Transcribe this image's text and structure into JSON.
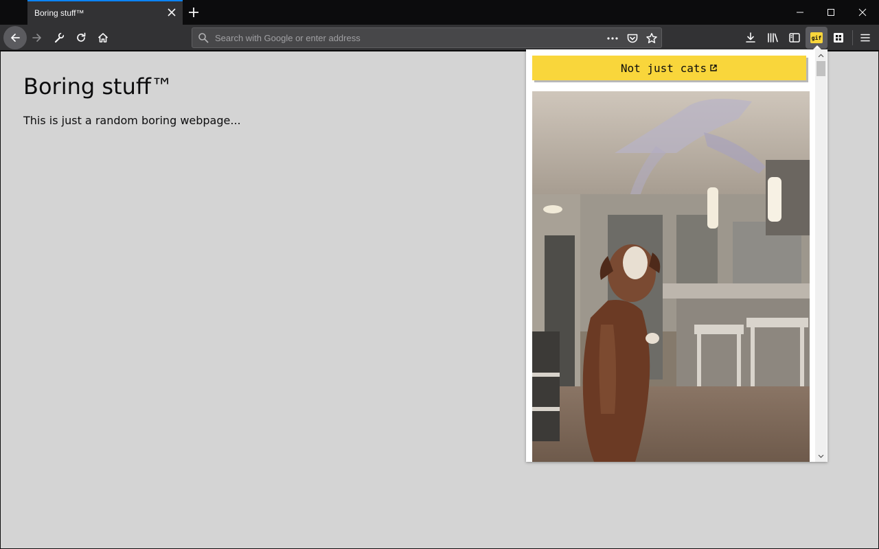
{
  "browser": {
    "tab_title": "Boring stuff™",
    "url_placeholder": "Search with Google or enter address"
  },
  "page": {
    "title": "Boring stuff™",
    "body": "This is just a random boring webpage..."
  },
  "popup": {
    "button_label": "Not just cats",
    "button_color": "#f9d63b",
    "image_description_icon": "external-link-icon",
    "image_subject": "dog-jumping-gif"
  },
  "toolbar_extension": {
    "badge_text": "gif",
    "badge_color": "#f9d63b"
  },
  "colors": {
    "tab_accent": "#0a84ff",
    "toolbar_bg": "#323234",
    "page_bg": "#d4d4d4"
  }
}
